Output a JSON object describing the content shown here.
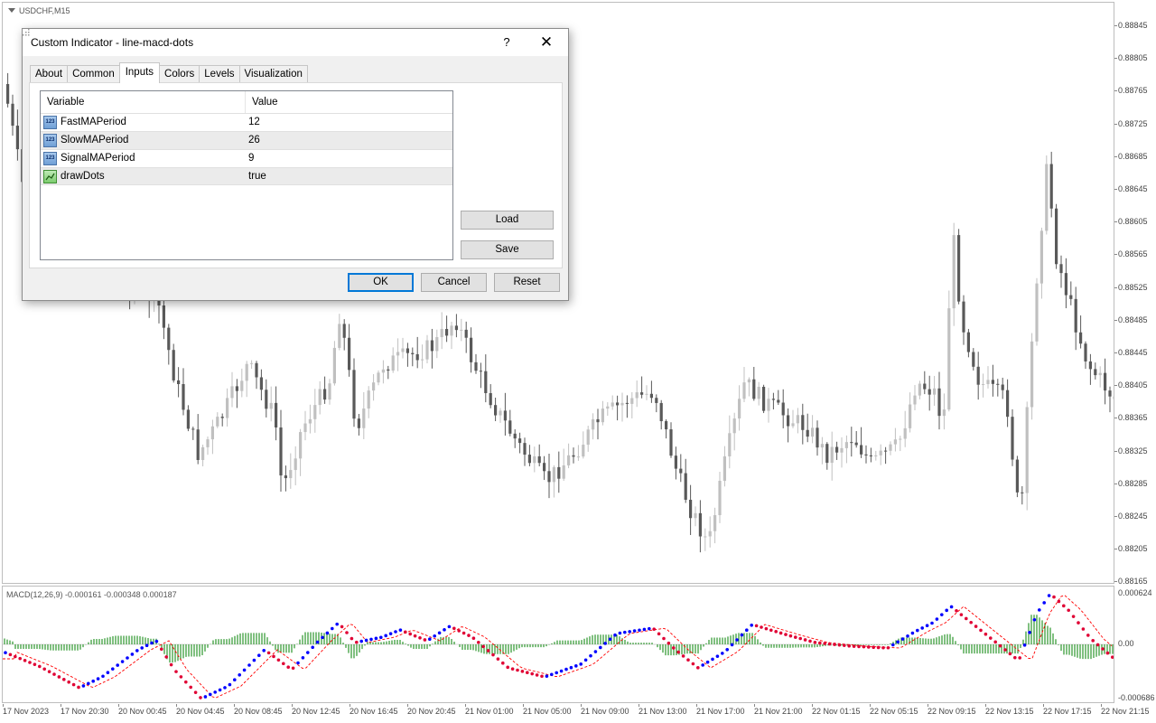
{
  "chart": {
    "title": "USDCHF,M15",
    "price_axis": [
      "0.88845",
      "0.88805",
      "0.88765",
      "0.88725",
      "0.88685",
      "0.88645",
      "0.88605",
      "0.88565",
      "0.88525",
      "0.88485",
      "0.88445",
      "0.88405",
      "0.88365",
      "0.88325",
      "0.88285",
      "0.88245",
      "0.88205",
      "0.88165"
    ],
    "macd_title": "MACD(12,26,9) -0.000161 -0.000348 0.000187",
    "macd_axis": [
      "0.000624",
      "0.00",
      "-0.000686"
    ],
    "time_axis": [
      "17 Nov 2023",
      "17 Nov 20:30",
      "20 Nov 00:45",
      "20 Nov 04:45",
      "20 Nov 08:45",
      "20 Nov 12:45",
      "20 Nov 16:45",
      "20 Nov 20:45",
      "21 Nov 01:00",
      "21 Nov 05:00",
      "21 Nov 09:00",
      "21 Nov 13:00",
      "21 Nov 17:00",
      "21 Nov 21:00",
      "22 Nov 01:15",
      "22 Nov 05:15",
      "22 Nov 09:15",
      "22 Nov 13:15",
      "22 Nov 17:15",
      "22 Nov 21:15"
    ],
    "colors": {
      "up_candle": "#c0c0c0",
      "down_candle": "#595959",
      "histogram": "#008000",
      "macd_dot_up": "#0000ff",
      "macd_dot_down": "#e00034",
      "signal_line": "#ff0000"
    }
  },
  "dialog": {
    "title": "Custom Indicator - line-macd-dots",
    "help": "?",
    "close": "✕",
    "tabs": [
      "About",
      "Common",
      "Inputs",
      "Colors",
      "Levels",
      "Visualization"
    ],
    "active_tab": "Inputs",
    "table": {
      "headers": [
        "Variable",
        "Value"
      ],
      "rows": [
        {
          "variable": "FastMAPeriod",
          "value": "12",
          "icon": "number-icon"
        },
        {
          "variable": "SlowMAPeriod",
          "value": "26",
          "icon": "number-icon"
        },
        {
          "variable": "SignalMAPeriod",
          "value": "9",
          "icon": "number-icon"
        },
        {
          "variable": "drawDots",
          "value": "true",
          "icon": "boolean-icon"
        }
      ]
    },
    "buttons": {
      "load": "Load",
      "save": "Save",
      "ok": "OK",
      "cancel": "Cancel",
      "reset": "Reset"
    }
  }
}
